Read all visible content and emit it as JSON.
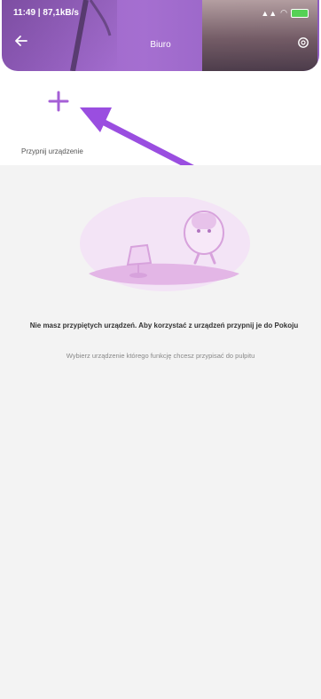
{
  "status_bar": {
    "time": "11:49 | 87,1kB/s",
    "battery": "100"
  },
  "header": {
    "title": "Biuro"
  },
  "pin": {
    "label": "Przypnij urządzenie"
  },
  "empty_state": {
    "title": "Nie masz przypiętych urządzeń. Aby korzystać z urządzeń przypnij je do Pokoju",
    "subtitle": "Wybierz urządzenie którego funkcję chcesz przypisać do pulpitu"
  },
  "colors": {
    "accent": "#a55fd6",
    "arrow": "#9a4ee0",
    "header": "#a56fd0"
  },
  "icons": {
    "back": "back-arrow-icon",
    "settings": "gear-icon",
    "add": "plus-icon"
  }
}
